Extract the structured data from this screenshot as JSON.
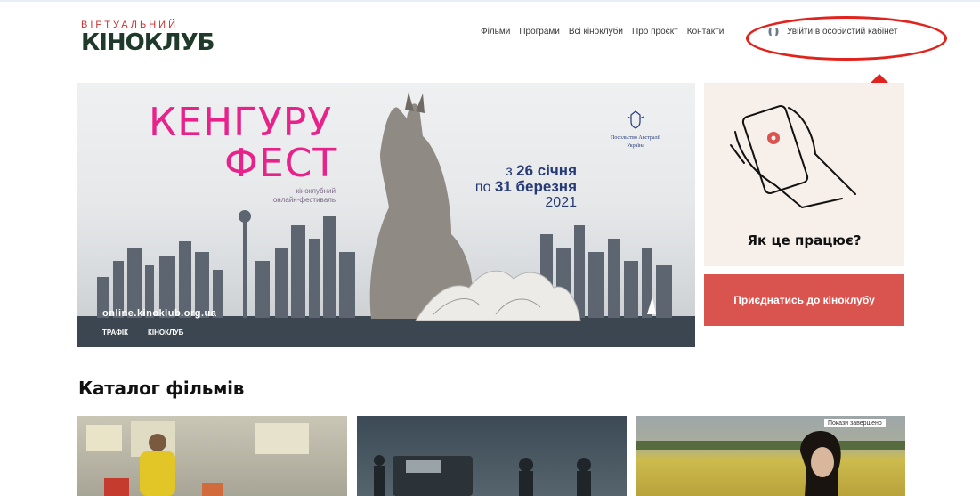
{
  "logo": {
    "line1": "ВІРТУАЛЬНИЙ",
    "line2": "КІНОКЛУБ"
  },
  "nav": {
    "items": [
      "Фільми",
      "Програми",
      "Всі кіноклуби",
      "Про проєкт",
      "Контакти"
    ]
  },
  "login": {
    "label": "Увійти в особистий кабінет"
  },
  "banner": {
    "title_line1": "КЕНГУРУ",
    "title_line2": "ФЕСТ",
    "subtitle_line1": "кіноклубний",
    "subtitle_line2": "онлайн-фестиваль",
    "dates_from_prefix": "з",
    "dates_from": "26 січня",
    "dates_to_prefix": "по",
    "dates_to": "31 березня",
    "year": "2021",
    "embassy_line1": "Посольство Австралії",
    "embassy_line2": "Україна",
    "url": "online.kinoklub.org.ua",
    "partner1": "ТРАФІК",
    "partner2": "КІНОКЛУБ"
  },
  "how_card": {
    "question": "Як це працює?"
  },
  "join_button": {
    "label": "Приєднатись до кіноклубу"
  },
  "catalog": {
    "title": "Каталог фільмів",
    "badge": "Покази завершено"
  },
  "colors": {
    "accent_red": "#e0231c",
    "brand_pink": "#e8228a",
    "join_bg": "#d9534f",
    "logo_red": "#c8312f",
    "logo_dark": "#1f3a2a"
  }
}
